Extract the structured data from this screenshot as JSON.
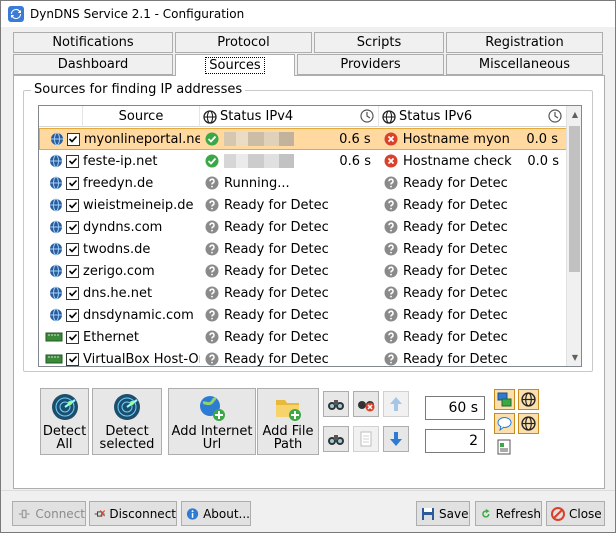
{
  "window": {
    "title": "DynDNS Service 2.1 - Configuration"
  },
  "tabs_top": [
    "Notifications",
    "Protocol",
    "Scripts",
    "Registration"
  ],
  "tabs_bottom": [
    "Dashboard",
    "Sources",
    "Providers",
    "Miscellaneous"
  ],
  "selected_tab": "Sources",
  "group": {
    "label": "Sources for finding IP addresses"
  },
  "grid": {
    "headers": {
      "source": "Source",
      "ipv4": "Status IPv4",
      "ipv6": "Status IPv6"
    },
    "rows": [
      {
        "type": "web",
        "checked": true,
        "source": "myonlineportal.net",
        "ipv4_status": "ok",
        "ipv4": "",
        "ipv4_time": "0.6 s",
        "ipv6_status": "err",
        "ipv6": "Hostname myon",
        "ipv6_time": "0.0 s",
        "selected": true
      },
      {
        "type": "web",
        "checked": true,
        "source": "feste-ip.net",
        "ipv4_status": "ok",
        "ipv4": "",
        "ipv4_time": "0.6 s",
        "ipv6_status": "err",
        "ipv6": "Hostname check",
        "ipv6_time": "0.0 s",
        "selected": false
      },
      {
        "type": "web",
        "checked": true,
        "source": "freedyn.de",
        "ipv4_status": "wait",
        "ipv4": "Running...",
        "ipv4_time": "",
        "ipv6_status": "wait",
        "ipv6": "Ready for Detec",
        "ipv6_time": "",
        "selected": false
      },
      {
        "type": "web",
        "checked": true,
        "source": "wieistmeineip.de",
        "ipv4_status": "wait",
        "ipv4": "Ready for Detec",
        "ipv4_time": "",
        "ipv6_status": "wait",
        "ipv6": "Ready for Detec",
        "ipv6_time": "",
        "selected": false
      },
      {
        "type": "web",
        "checked": true,
        "source": "dyndns.com",
        "ipv4_status": "wait",
        "ipv4": "Ready for Detec",
        "ipv4_time": "",
        "ipv6_status": "wait",
        "ipv6": "Ready for Detec",
        "ipv6_time": "",
        "selected": false
      },
      {
        "type": "web",
        "checked": true,
        "source": "twodns.de",
        "ipv4_status": "wait",
        "ipv4": "Ready for Detec",
        "ipv4_time": "",
        "ipv6_status": "wait",
        "ipv6": "Ready for Detec",
        "ipv6_time": "",
        "selected": false
      },
      {
        "type": "web",
        "checked": true,
        "source": "zerigo.com",
        "ipv4_status": "wait",
        "ipv4": "Ready for Detec",
        "ipv4_time": "",
        "ipv6_status": "wait",
        "ipv6": "Ready for Detec",
        "ipv6_time": "",
        "selected": false
      },
      {
        "type": "web",
        "checked": true,
        "source": "dns.he.net",
        "ipv4_status": "wait",
        "ipv4": "Ready for Detec",
        "ipv4_time": "",
        "ipv6_status": "wait",
        "ipv6": "Ready for Detec",
        "ipv6_time": "",
        "selected": false
      },
      {
        "type": "web",
        "checked": true,
        "source": "dnsdynamic.com",
        "ipv4_status": "wait",
        "ipv4": "Ready for Detec",
        "ipv4_time": "",
        "ipv6_status": "wait",
        "ipv6": "Ready for Detec",
        "ipv6_time": "",
        "selected": false
      },
      {
        "type": "nic",
        "checked": true,
        "source": "Ethernet",
        "ipv4_status": "wait",
        "ipv4": "Ready for Detec",
        "ipv4_time": "",
        "ipv6_status": "wait",
        "ipv6": "Ready for Detec",
        "ipv6_time": "",
        "selected": false
      },
      {
        "type": "nic",
        "checked": true,
        "source": "VirtualBox Host-Only",
        "ipv4_status": "wait",
        "ipv4": "Ready for Detec",
        "ipv4_time": "",
        "ipv6_status": "wait",
        "ipv6": "Ready for Detec",
        "ipv6_time": "",
        "selected": false
      }
    ]
  },
  "actions": {
    "detect_all": "Detect\nAll",
    "detect_selected": "Detect\nselected",
    "add_internet_url": "Add Internet\nUrl",
    "add_file_path": "Add File\nPath"
  },
  "timeout": {
    "value": "60 s"
  },
  "retries": {
    "value": "2"
  },
  "bottom": {
    "connect": "Connect",
    "disconnect": "Disconnect",
    "about": "About...",
    "save": "Save",
    "refresh": "Refresh",
    "close": "Close"
  },
  "colors": {
    "selected_row": "#ffd9a0",
    "ok": "#3aa845",
    "err": "#d9412b",
    "wait": "#8a8a8a"
  }
}
